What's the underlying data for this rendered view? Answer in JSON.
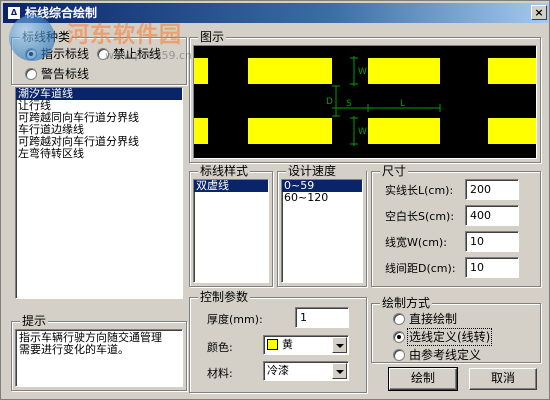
{
  "window": {
    "title": "标线综合绘制",
    "app_icon": "app-icon",
    "close_label": "×"
  },
  "watermark": {
    "text": "河东软件园",
    "url": "www.pc0359.cn"
  },
  "type_group": {
    "label": "标线种类",
    "radios": [
      {
        "label": "指示标线",
        "checked": true
      },
      {
        "label": "禁止标线",
        "checked": false
      },
      {
        "label": "警告标线",
        "checked": false
      }
    ]
  },
  "marking_list": {
    "items": [
      {
        "label": "潮汐车道线",
        "selected": true
      },
      {
        "label": "让行线",
        "selected": false
      },
      {
        "label": "可跨越同向车行道分界线",
        "selected": false
      },
      {
        "label": "车行道边缘线",
        "selected": false
      },
      {
        "label": "可跨越对向车行道分界线",
        "selected": false
      },
      {
        "label": "左弯待转区线",
        "selected": false
      }
    ]
  },
  "hint": {
    "label": "提示",
    "text_line1": "指示车辆行驶方向随交通管理",
    "text_line2": "需要进行变化的车道。"
  },
  "preview": {
    "label": "图示",
    "dim_labels": [
      "W",
      "W",
      "D",
      "S",
      "L"
    ],
    "colors": {
      "background": "#000000",
      "marking": "#ffff00",
      "dimension": "#00a000"
    }
  },
  "style_group": {
    "label": "标线样式",
    "items": [
      {
        "label": "双虚线",
        "selected": true
      }
    ]
  },
  "speed_group": {
    "label": "设计速度(km/h)",
    "items": [
      {
        "label": "0~59",
        "selected": true
      },
      {
        "label": "60~120",
        "selected": false
      }
    ]
  },
  "size_group": {
    "label": "尺寸",
    "fields": [
      {
        "label": "实线长L(cm):",
        "value": "200"
      },
      {
        "label": "空白长S(cm):",
        "value": "400"
      },
      {
        "label": "线宽W(cm):",
        "value": "10"
      },
      {
        "label": "线间距D(cm):",
        "value": "10"
      }
    ]
  },
  "control_group": {
    "label": "控制参数",
    "thickness_label": "厚度(mm):",
    "thickness_value": "1",
    "color_label": "颜色:",
    "color_value": "黄",
    "color_swatch": "#ffff00",
    "material_label": "材料:",
    "material_value": "冷漆"
  },
  "draw_group": {
    "label": "绘制方式",
    "radios": [
      {
        "label": "直接绘制",
        "checked": false
      },
      {
        "label": "选线定义(线转)",
        "checked": true
      },
      {
        "label": "由参考线定义",
        "checked": false
      }
    ]
  },
  "buttons": {
    "draw": "绘制",
    "cancel": "取消"
  },
  "theme": {
    "selection": "#0a246a",
    "titlebar_start": "#0a246a",
    "titlebar_end": "#a6caf0",
    "face": "#d4d0c8"
  }
}
